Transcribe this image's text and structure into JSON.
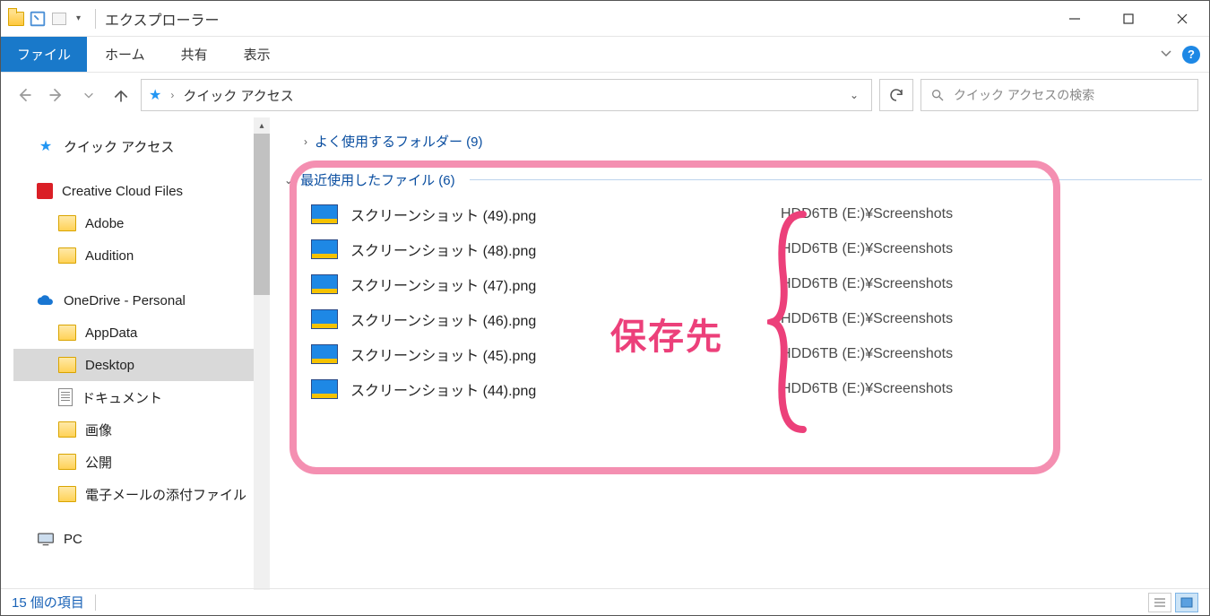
{
  "window": {
    "title": "エクスプローラー"
  },
  "ribbon": {
    "file": "ファイル",
    "tabs": [
      "ホーム",
      "共有",
      "表示"
    ]
  },
  "address": {
    "location": "クイック アクセス"
  },
  "search": {
    "placeholder": "クイック アクセスの検索"
  },
  "sidebar": {
    "quick_access": "クイック アクセス",
    "creative_cloud": "Creative Cloud Files",
    "adobe": "Adobe",
    "audition": "Audition",
    "onedrive": "OneDrive - Personal",
    "appdata": "AppData",
    "desktop": "Desktop",
    "documents": "ドキュメント",
    "pictures": "画像",
    "public": "公開",
    "email": "電子メールの添付ファイル",
    "pc": "PC"
  },
  "groups": {
    "frequent": "よく使用するフォルダー (9)",
    "recent": "最近使用したファイル (6)"
  },
  "files": [
    {
      "name": "スクリーンショット (49).png",
      "path": "HDD6TB (E:)¥Screenshots"
    },
    {
      "name": "スクリーンショット (48).png",
      "path": "HDD6TB (E:)¥Screenshots"
    },
    {
      "name": "スクリーンショット (47).png",
      "path": "HDD6TB (E:)¥Screenshots"
    },
    {
      "name": "スクリーンショット (46).png",
      "path": "HDD6TB (E:)¥Screenshots"
    },
    {
      "name": "スクリーンショット (45).png",
      "path": "HDD6TB (E:)¥Screenshots"
    },
    {
      "name": "スクリーンショット (44).png",
      "path": "HDD6TB (E:)¥Screenshots"
    }
  ],
  "annotation": {
    "label": "保存先"
  },
  "status": {
    "text": "15 個の項目"
  }
}
